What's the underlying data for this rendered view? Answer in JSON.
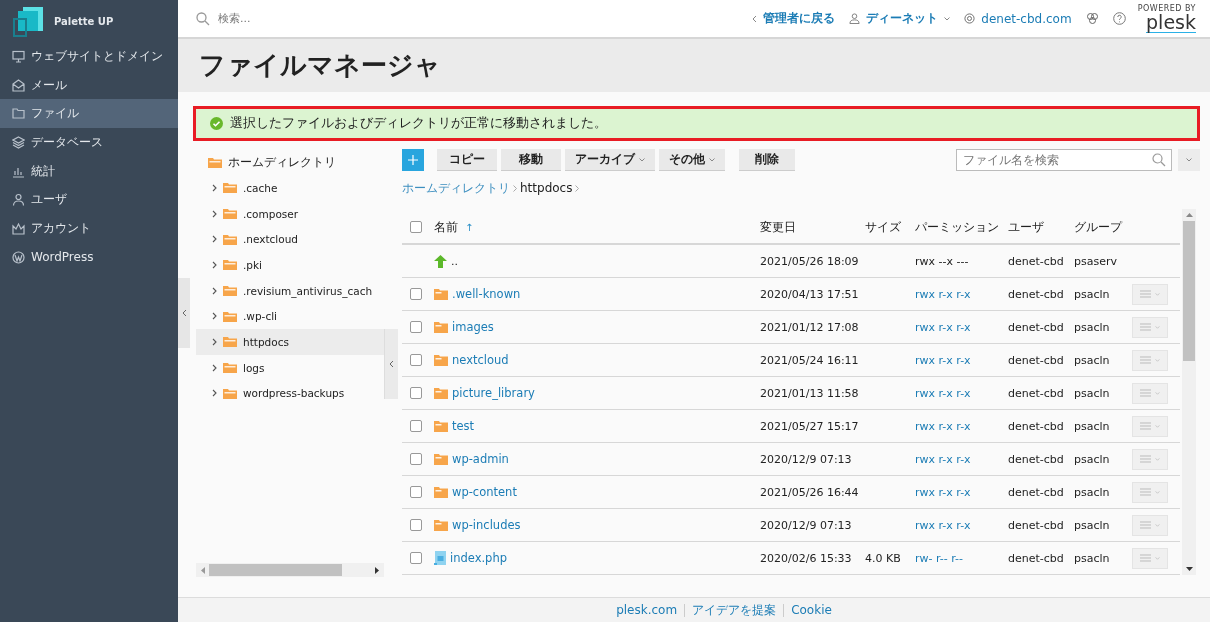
{
  "brand": {
    "name": "Palette UP"
  },
  "sidebar": {
    "items": [
      {
        "label": "ウェブサイトとドメイン",
        "selected": false
      },
      {
        "label": "メール",
        "selected": false
      },
      {
        "label": "ファイル",
        "selected": true
      },
      {
        "label": "データベース",
        "selected": false
      },
      {
        "label": "統計",
        "selected": false
      },
      {
        "label": "ユーザ",
        "selected": false
      },
      {
        "label": "アカウント",
        "selected": false
      },
      {
        "label": "WordPress",
        "selected": false
      }
    ]
  },
  "topbar": {
    "search": {
      "placeholder": "検索..."
    },
    "back_link": "管理者に戻る",
    "user": "ディーネット",
    "domain": "denet-cbd.com",
    "logo": {
      "caption": "POWERED BY",
      "name": "plesk"
    }
  },
  "page_title": "ファイルマネージャ",
  "message": {
    "kind": "success",
    "text": "選択したファイルおよびディレクトリが正常に移動されました。"
  },
  "tree": {
    "root": "ホームディレクトリ",
    "children": [
      {
        "label": ".cache",
        "selected": false
      },
      {
        "label": ".composer",
        "selected": false
      },
      {
        "label": ".nextcloud",
        "selected": false
      },
      {
        "label": ".pki",
        "selected": false
      },
      {
        "label": ".revisium_antivirus_cach",
        "selected": false
      },
      {
        "label": ".wp-cli",
        "selected": false
      },
      {
        "label": "httpdocs",
        "selected": true
      },
      {
        "label": "logs",
        "selected": false
      },
      {
        "label": "wordpress-backups",
        "selected": false
      }
    ]
  },
  "toolbar": {
    "buttons": [
      {
        "label": "コピー",
        "dropdown": false
      },
      {
        "label": "移動",
        "dropdown": false
      },
      {
        "label": "アーカイブ",
        "dropdown": true
      },
      {
        "label": "その他",
        "dropdown": true
      },
      {
        "label": "削除",
        "dropdown": false
      }
    ],
    "search": {
      "placeholder": "ファイル名を検索"
    }
  },
  "breadcrumb": [
    {
      "label": "ホームディレクトリ",
      "link": true
    },
    {
      "label": "httpdocs",
      "link": false
    }
  ],
  "table": {
    "columns": [
      "名前",
      "変更日",
      "サイズ",
      "パーミッション",
      "ユーザ",
      "グループ"
    ],
    "sort_arrow": "↑",
    "select_all_checked": false,
    "rows": [
      {
        "kind": "parent",
        "name": "..",
        "modified": "2021/05/26 18:09",
        "permissions": "rwx --x ---",
        "user": "denet-cbd",
        "group": "psaserv"
      },
      {
        "kind": "folder",
        "checked": false,
        "name": ".well-known",
        "modified": "2020/04/13 17:51",
        "permissions": "rwx r-x r-x",
        "user": "denet-cbd",
        "group": "psacln"
      },
      {
        "kind": "folder",
        "checked": false,
        "name": "images",
        "modified": "2021/01/12 17:08",
        "permissions": "rwx r-x r-x",
        "user": "denet-cbd",
        "group": "psacln"
      },
      {
        "kind": "folder",
        "checked": false,
        "name": "nextcloud",
        "modified": "2021/05/24 16:11",
        "permissions": "rwx r-x r-x",
        "user": "denet-cbd",
        "group": "psacln"
      },
      {
        "kind": "folder",
        "checked": false,
        "name": "picture_library",
        "modified": "2021/01/13 11:58",
        "permissions": "rwx r-x r-x",
        "user": "denet-cbd",
        "group": "psacln"
      },
      {
        "kind": "folder",
        "checked": false,
        "name": "test",
        "modified": "2021/05/27 15:17",
        "permissions": "rwx r-x r-x",
        "user": "denet-cbd",
        "group": "psacln"
      },
      {
        "kind": "folder",
        "checked": false,
        "name": "wp-admin",
        "modified": "2020/12/9 07:13",
        "permissions": "rwx r-x r-x",
        "user": "denet-cbd",
        "group": "psacln"
      },
      {
        "kind": "folder",
        "checked": false,
        "name": "wp-content",
        "modified": "2021/05/26 16:44",
        "permissions": "rwx r-x r-x",
        "user": "denet-cbd",
        "group": "psacln"
      },
      {
        "kind": "folder",
        "checked": false,
        "name": "wp-includes",
        "modified": "2020/12/9 07:13",
        "permissions": "rwx r-x r-x",
        "user": "denet-cbd",
        "group": "psacln"
      },
      {
        "kind": "file",
        "checked": false,
        "name": "index.php",
        "modified": "2020/02/6 15:33",
        "size": "4.0 KB",
        "permissions": "rw- r-- r--",
        "user": "denet-cbd",
        "group": "psacln"
      }
    ]
  },
  "footer": {
    "links": [
      "plesk.com",
      "アイデアを提案",
      "Cookie"
    ]
  }
}
